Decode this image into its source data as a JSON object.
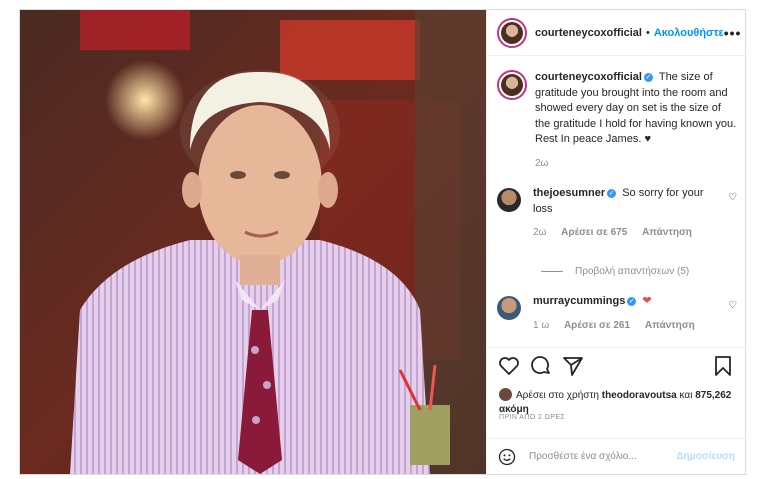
{
  "header": {
    "username": "courteneycoxofficial",
    "separator": "•",
    "follow_label": "Ακολουθήστε",
    "more_label": "•••"
  },
  "caption": {
    "username": "courteneycoxofficial",
    "text": "The size of gratitude you brought into the room and showed every day on set is the size of the gratitude I hold for having known you. Rest In peace James. ♥",
    "age": "2ω"
  },
  "comments": [
    {
      "username": "thejoesumner",
      "text": "So sorry for your loss",
      "age": "2ω",
      "likes": "Αρέσει σε 675",
      "reply_label": "Απάντηση"
    },
    {
      "username": "murraycummings",
      "text": "❤",
      "age": "1 ω",
      "likes": "Αρέσει σε 261",
      "reply_label": "Απάντηση"
    }
  ],
  "view_replies": "Προβολή απαντήσεων (5)",
  "likes": {
    "prefix": "Αρέσει στο χρήστη",
    "user": "theodoravoutsa",
    "and": "και",
    "count": "875,262 ακόμη"
  },
  "timestamp": "ΠΡΙΝ ΑΠΟ 2 ΩΡΕΣ",
  "comment_box": {
    "placeholder": "Προσθέστε ένα σχόλιο...",
    "post_label": "Δημοσίευση"
  },
  "colors": {
    "link_blue": "#0095f6",
    "verified_blue": "#3897f0",
    "heart_red": "#ed4956"
  }
}
